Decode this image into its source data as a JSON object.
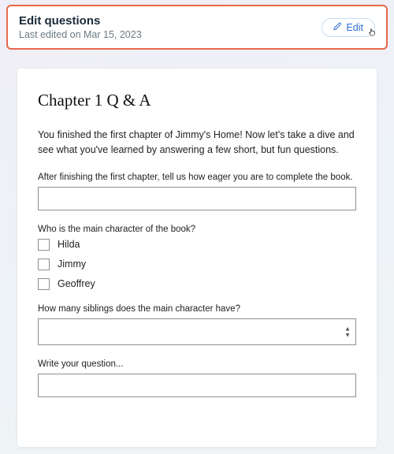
{
  "header": {
    "title": "Edit questions",
    "subtitle": "Last edited on Mar 15, 2023",
    "edit_label": "Edit"
  },
  "card": {
    "title": "Chapter 1 Q & A",
    "intro": "You finished the first chapter of Jimmy's Home! Now let's take a dive and see what you've learned by answering a few short, but fun questions."
  },
  "questions": {
    "q1": {
      "label": "After finishing the first chapter, tell us how eager you are to complete the book.",
      "value": ""
    },
    "q2": {
      "label": "Who is the main character of the book?",
      "options": [
        "Hilda",
        "Jimmy",
        "Geoffrey"
      ]
    },
    "q3": {
      "label": "How many siblings does the main character have?",
      "value": ""
    },
    "q4": {
      "label": "Write your question...",
      "value": ""
    }
  }
}
